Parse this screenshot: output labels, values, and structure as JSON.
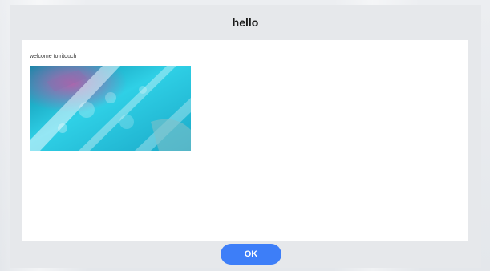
{
  "dialog": {
    "title": "hello",
    "message": "welcome to ritouch",
    "image": "aquatic-photo",
    "ok_label": "OK",
    "accent_color": "#3d7ef8"
  }
}
